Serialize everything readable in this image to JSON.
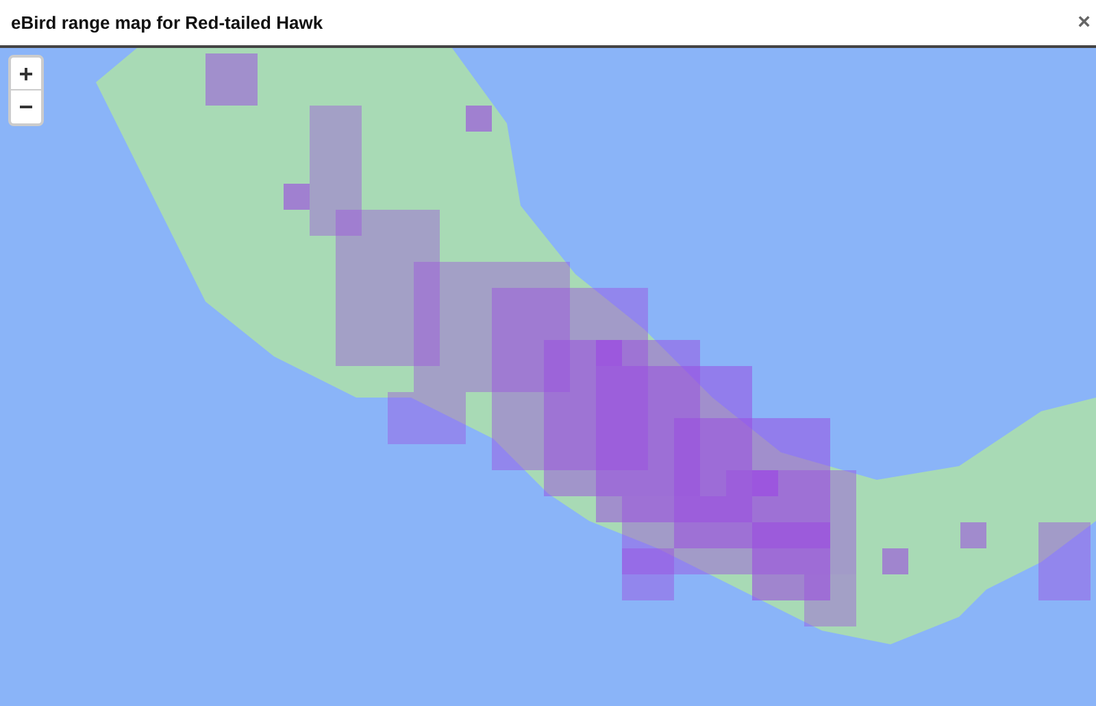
{
  "window": {
    "title": "eBird range map for Red-tailed Hawk",
    "close": "×"
  },
  "zoom_controls": {
    "zoom_in": "+",
    "zoom_out": "−"
  }
}
